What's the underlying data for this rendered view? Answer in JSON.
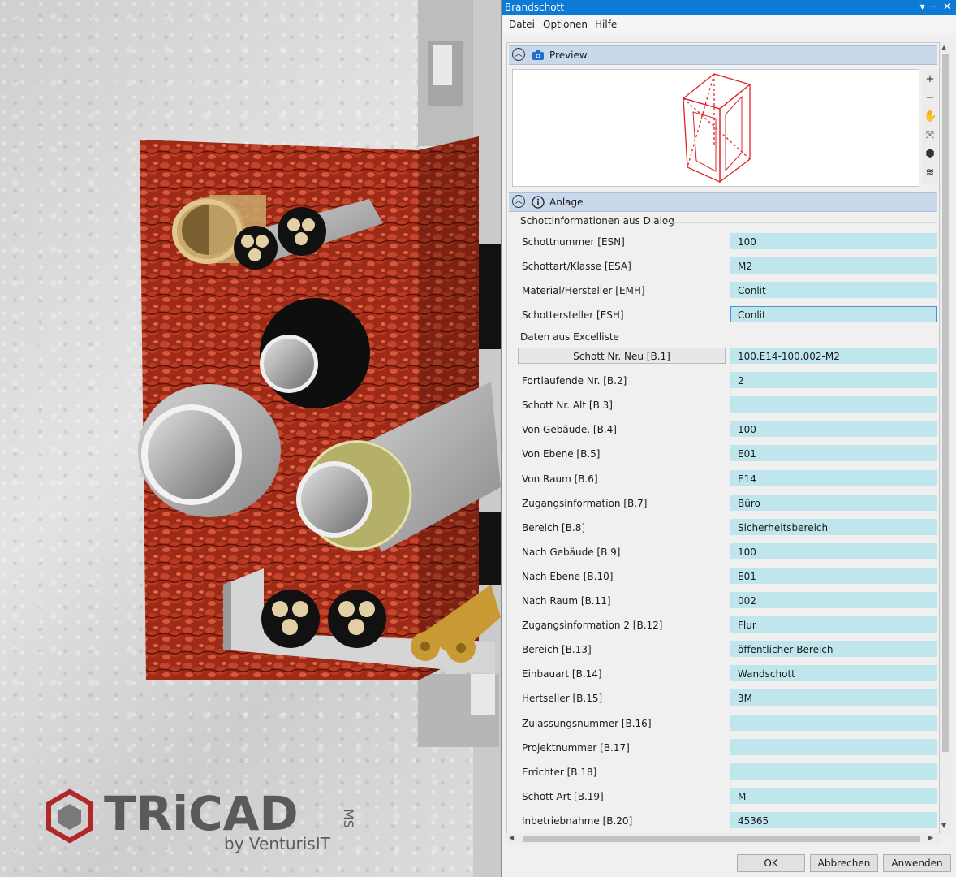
{
  "window": {
    "title": "Brandschott",
    "buttons": [
      "▾",
      "⊣",
      "✕"
    ]
  },
  "menu": [
    "Datei",
    "Optionen",
    "Hilfe"
  ],
  "sections": {
    "preview": {
      "label": "Preview"
    },
    "anlage": {
      "label": "Anlage"
    }
  },
  "preview_tools": [
    "+",
    "−",
    "✋",
    "⤧",
    "⬢",
    "≋"
  ],
  "groups": {
    "dialog": "Schottinformationen aus Dialog",
    "excel": "Daten aus Excelliste"
  },
  "dialog_fields": [
    {
      "label": "Schottnummer [ESN]",
      "value": "100"
    },
    {
      "label": "Schottart/Klasse [ESA]",
      "value": "M2"
    },
    {
      "label": "Material/Hersteller [EMH]",
      "value": "Conlit"
    },
    {
      "label": "Schottersteller [ESH]",
      "value": "Conlit"
    }
  ],
  "excel_fields": [
    {
      "label": "Schott Nr. Neu [B.1]",
      "value": "100.E14-100.002-M2"
    },
    {
      "label": "Fortlaufende Nr. [B.2]",
      "value": "2"
    },
    {
      "label": "Schott Nr. Alt [B.3]",
      "value": ""
    },
    {
      "label": "Von Gebäude. [B.4]",
      "value": "100"
    },
    {
      "label": "Von Ebene [B.5]",
      "value": "E01"
    },
    {
      "label": "Von Raum [B.6]",
      "value": "E14"
    },
    {
      "label": "Zugangsinformation [B.7]",
      "value": "Büro"
    },
    {
      "label": "Bereich [B.8]",
      "value": "Sicherheitsbereich"
    },
    {
      "label": "Nach Gebäude [B.9]",
      "value": "100"
    },
    {
      "label": "Nach Ebene [B.10]",
      "value": "E01"
    },
    {
      "label": "Nach Raum [B.11]",
      "value": "002"
    },
    {
      "label": "Zugangsinformation 2 [B.12]",
      "value": "Flur"
    },
    {
      "label": "Bereich [B.13]",
      "value": "öffentlicher Bereich"
    },
    {
      "label": "Einbauart [B.14]",
      "value": "Wandschott"
    },
    {
      "label": "Hertseller [B.15]",
      "value": "3M"
    },
    {
      "label": "Zulassungsnummer [B.16]",
      "value": ""
    },
    {
      "label": "Projektnummer [B.17]",
      "value": ""
    },
    {
      "label": "Errichter [B.18]",
      "value": ""
    },
    {
      "label": "Schott Art [B.19]",
      "value": "M"
    },
    {
      "label": "Inbetriebnahme [B.20]",
      "value": "45365"
    }
  ],
  "buttons": {
    "ok": "OK",
    "cancel": "Abbrechen",
    "apply": "Anwenden"
  },
  "logo": {
    "brand": "TRiCAD",
    "suffix": "MS",
    "tagline": "by VenturisIT"
  },
  "colors": {
    "titlebar": "#0d7bd5",
    "field": "#bfe6ec",
    "section": "#c9d8ea",
    "firestop": "#a8301c"
  }
}
